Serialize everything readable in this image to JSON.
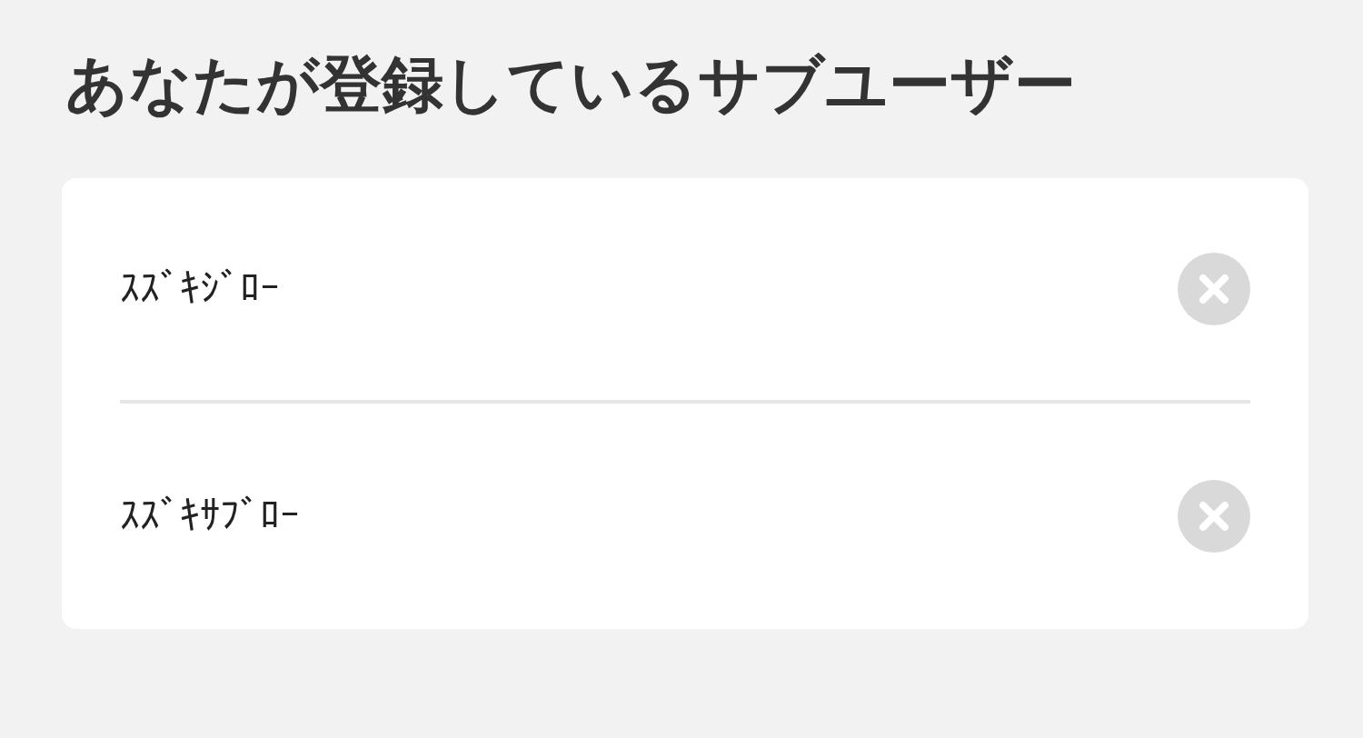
{
  "title": "あなたが登録しているサブユーザー",
  "sub_users": [
    {
      "name": "ｽｽﾞｷｼﾞﾛｰ"
    },
    {
      "name": "ｽｽﾞｷｻﾌﾞﾛｰ"
    }
  ]
}
